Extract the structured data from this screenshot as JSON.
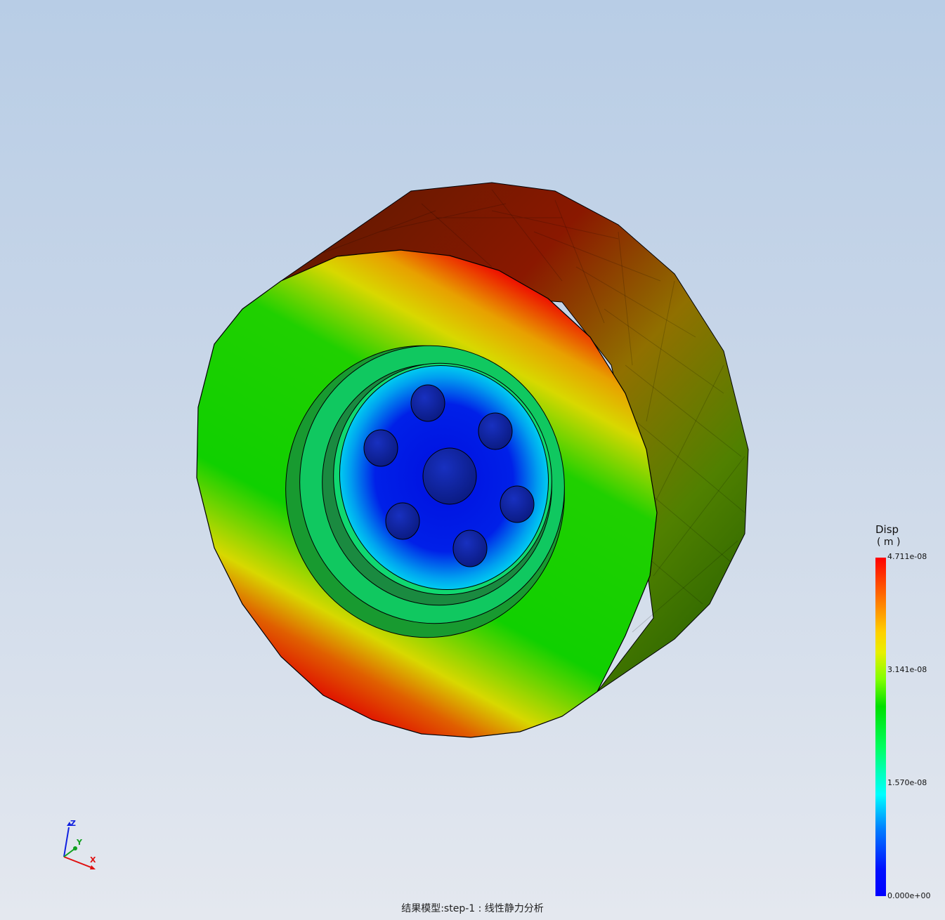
{
  "legend": {
    "title": "Disp",
    "unit": "( m )",
    "ticks": [
      "4.711e-08",
      "3.141e-08",
      "1.570e-08",
      "0.000e+00"
    ]
  },
  "triad": {
    "z": "Z",
    "y": "Y",
    "x": "X"
  },
  "caption": "结果模型:step-1 : 线性静力分析",
  "colors": {
    "max": "#ff0000",
    "high": "#e0e000",
    "mid": "#00dd00",
    "low": "#00eeee",
    "min": "#0010e0"
  }
}
